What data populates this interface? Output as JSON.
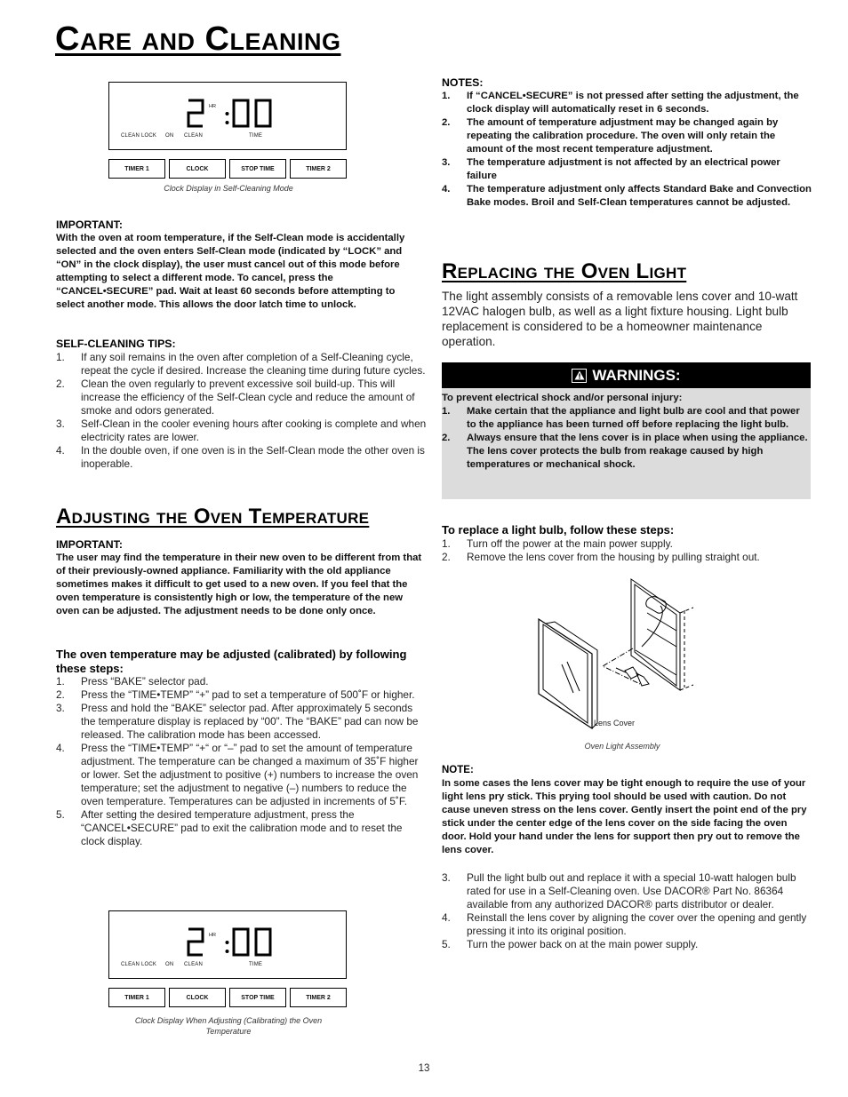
{
  "page": {
    "title": "Care and Cleaning",
    "page_number": "13"
  },
  "clock_display": {
    "hour": "2",
    "hr_label": "HR",
    "minutes": "00",
    "indicators": [
      "CLEAN",
      "LOCK",
      "ON",
      "CLEAN",
      "TIME"
    ],
    "pads": [
      "TIMER 1",
      "CLOCK",
      "STOP TIME",
      "TIMER 2"
    ],
    "caption_top": "Clock Display in Self-Cleaning Mode",
    "caption_bottom": "Clock Display When Adjusting (Calibrating) the Oven Temperature"
  },
  "important_clean": {
    "label": "IMPORTANT:",
    "text": "With the oven at room temperature, if the Self-Clean mode is accidentally selected and the oven enters Self-Clean mode (indicated by “LOCK” and “ON” in the clock display), the user must cancel out of this mode before attempting to select a different mode. To cancel, press the “CANCEL•SECURE” pad. Wait at least 60 seconds before attempting to select another mode. This  allows the door latch time to unlock."
  },
  "self_cleaning_tips": {
    "label": "SELF-CLEANING TIPS:",
    "items": [
      {
        "num": "1.",
        "text": "If any soil remains in the oven after completion of a Self-Cleaning cycle, repeat the cycle if desired. Increase the cleaning time during future cycles."
      },
      {
        "num": "2.",
        "text": "Clean the oven regularly to prevent excessive soil build-up. This will increase the efficiency of the Self-Clean cycle and reduce the amount of smoke and odors generated."
      },
      {
        "num": "3.",
        "text": "Self-Clean in the cooler evening hours after cooking is complete and when electricity rates are lower."
      },
      {
        "num": "4.",
        "text": "In the double oven, if one oven is in the Self-Clean mode the other oven is inoperable."
      }
    ]
  },
  "adjusting": {
    "title": "Adjusting the Oven Temperature",
    "important_label": "IMPORTANT:",
    "important_text": "The user may find the temperature in their new oven to be different from that of their previously-owned appliance. Familiarity with the old appliance sometimes makes it difficult to get used to a new oven. If you feel that the oven temperature is consistently high or low, the temperature of the new oven can be adjusted. The adjustment needs to be done only once.",
    "steps_label": "The oven temperature may be adjusted (calibrated) by following these steps:",
    "steps": [
      {
        "num": "1.",
        "text": "Press “BAKE” selector pad."
      },
      {
        "num": "2.",
        "text": "Press the “TIME•TEMP” “+” pad to set a temperature of 500˚F or higher."
      },
      {
        "num": "3.",
        "text": "Press and hold the “BAKE” selector pad. After approximately 5 seconds the temperature display is replaced by “00”. The “BAKE” pad can now be released. The calibration mode has been accessed."
      },
      {
        "num": "4.",
        "text": "Press the “TIME•TEMP” “+“ or “–” pad to set the amount of temperature adjustment. The temperature can be changed a maximum of 35˚F higher or lower. Set the adjustment to positive (+) numbers to increase the oven temperature; set the adjustment to negative (–) numbers to reduce the oven temperature. Temperatures can be adjusted in increments of 5˚F."
      },
      {
        "num": "5.",
        "text": "After setting the desired temperature adjustment, press the “CANCEL•SECURE” pad to exit the calibration mode and to reset the clock display."
      }
    ]
  },
  "notes": {
    "label": "NOTES:",
    "items": [
      {
        "num": "1.",
        "text": "If “CANCEL•SECURE” is not pressed after setting the adjustment, the clock display will automatically reset in 6 seconds."
      },
      {
        "num": "2.",
        "text": "The amount of temperature adjustment may be changed again by repeating the calibration procedure. The oven will only retain the amount of the most recent temperature adjustment."
      },
      {
        "num": "3.",
        "text": "The temperature adjustment is not affected by an electrical power failure"
      },
      {
        "num": "4.",
        "text": "The temperature adjustment only affects Standard Bake and Convection Bake modes. Broil and Self-Clean temperatures cannot be adjusted."
      }
    ]
  },
  "replacing": {
    "title": "Replacing the Oven Light",
    "intro": "The light assembly consists of a removable lens cover and 10-watt 12VAC halogen bulb, as well as a light fixture housing. Light bulb replacement is considered to be a homeowner maintenance operation.",
    "warnings": {
      "heading": "WARNINGS:",
      "icon": "warning-triangle-icon",
      "lead": "To prevent electrical shock and/or personal injury:",
      "items": [
        {
          "num": "1.",
          "text": "Make certain that the appliance and light bulb are cool and that power to the appliance has been turned off before replacing the light bulb."
        },
        {
          "num": "2.",
          "text": "Always ensure that the lens cover is in place when using the appliance.  The lens cover protects the bulb from reakage caused by high temperatures or mechanical shock."
        }
      ],
      "colors": {
        "header_bg": "#000000",
        "body_bg": "#dcdcdc"
      }
    },
    "steps_label": "To replace a light bulb, follow these steps:",
    "steps_a": [
      {
        "num": "1.",
        "text": "Turn off the power at the main power supply."
      },
      {
        "num": "2.",
        "text": "Remove the lens cover from the housing by pulling straight out."
      }
    ],
    "figure": {
      "label": "Lens Cover",
      "caption": "Oven Light Assembly"
    },
    "note_label": "NOTE:",
    "note_text": "In some cases the lens cover may be tight enough to require the use of your light lens pry stick. This prying tool should be used with caution. Do not cause uneven stress on the lens cover. Gently insert the point end of the pry stick under the center edge of the lens cover on the side facing the oven door. Hold your hand under the lens for support then pry out to remove the lens cover.",
    "steps_b": [
      {
        "num": "3.",
        "text": "Pull the light bulb out and replace it with a special 10-watt halogen bulb rated for use in a Self-Cleaning oven. Use DACOR® Part No. 86364 available from any authorized DACOR® parts distributor or dealer."
      },
      {
        "num": "4.",
        "text": "Reinstall the lens cover by aligning the cover over the opening and gently pressing it into its original position."
      },
      {
        "num": "5.",
        "text": "Turn the power back on at the main power supply."
      }
    ]
  }
}
